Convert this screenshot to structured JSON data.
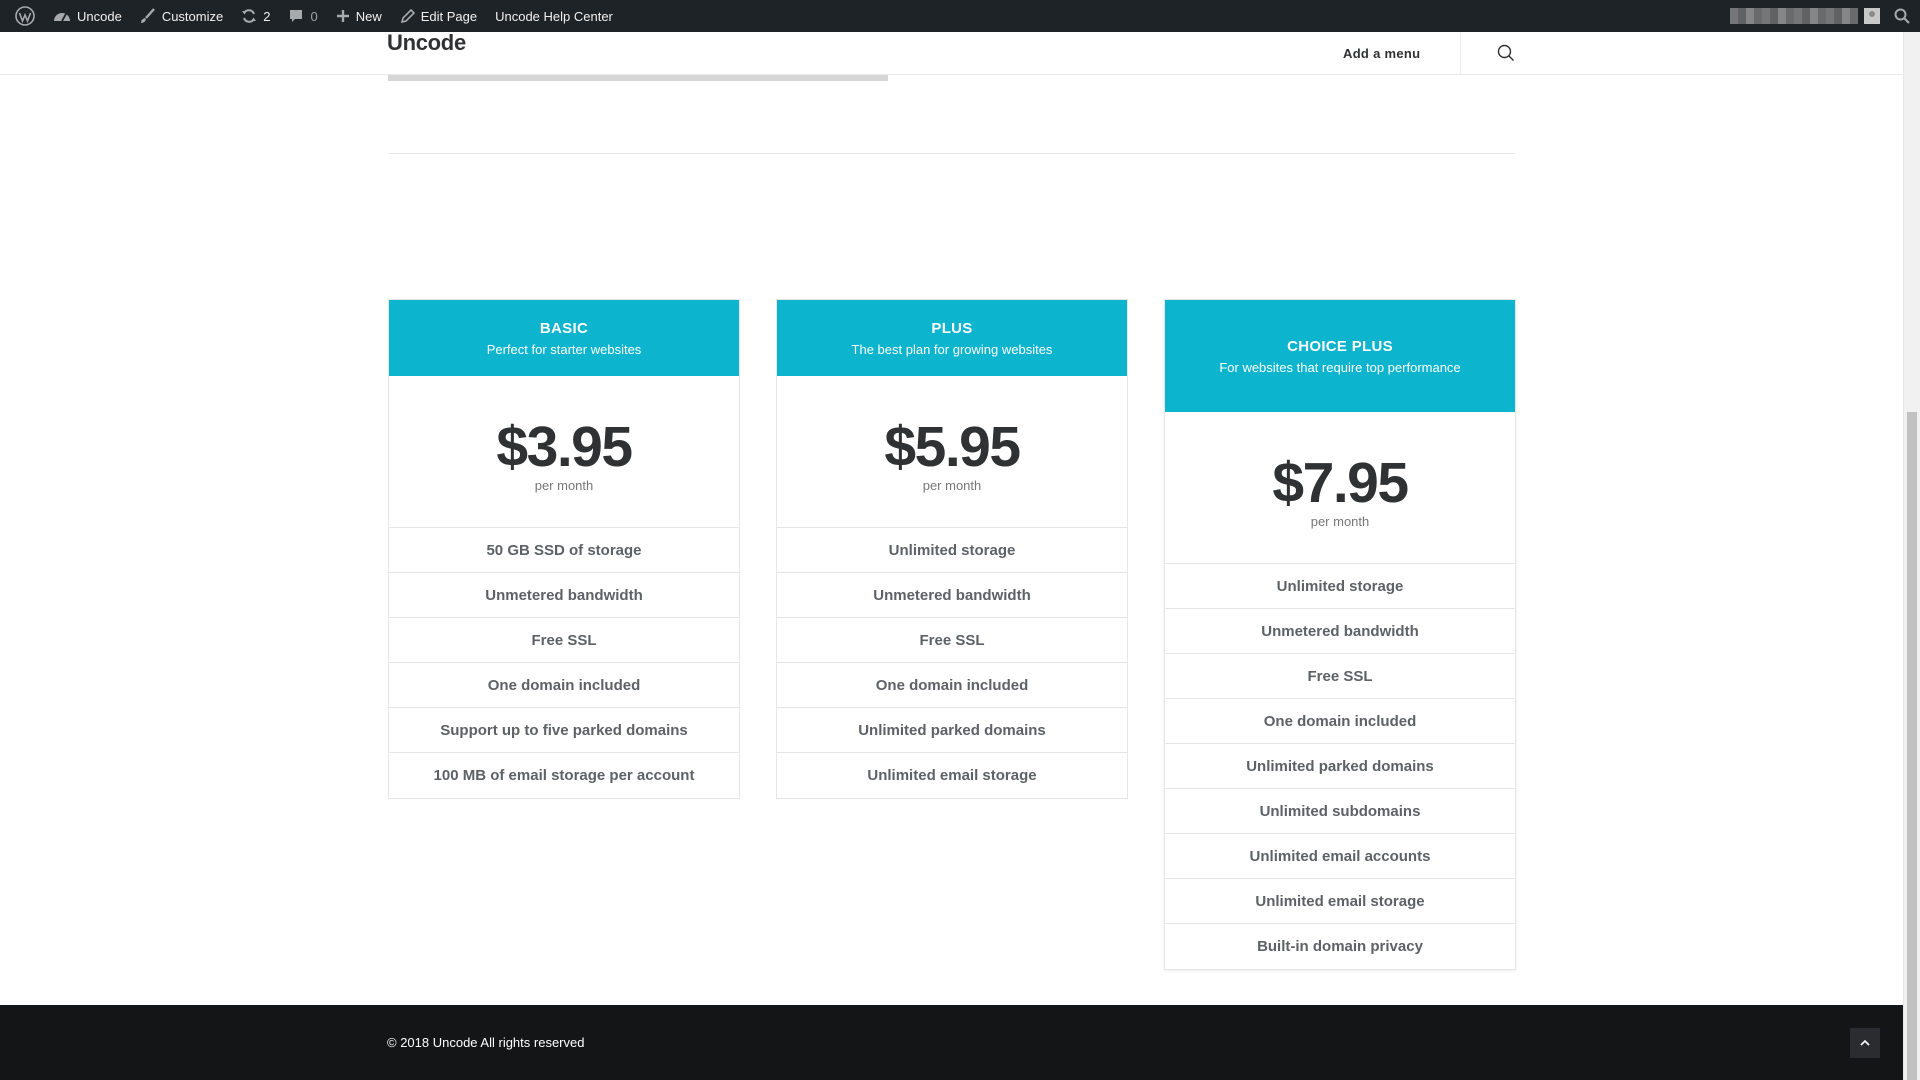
{
  "admin_bar": {
    "site_name": "Uncode",
    "customize": "Customize",
    "updates_count": "2",
    "comments_count": "0",
    "new_label": "New",
    "edit_page": "Edit Page",
    "help_center": "Uncode Help Center"
  },
  "header": {
    "logo": "Uncode",
    "menu_link": "Add a menu"
  },
  "plans": [
    {
      "name": "BASIC",
      "tagline": "Perfect for starter websites",
      "price": "$3.95",
      "period": "per month",
      "features": [
        "50 GB SSD of storage",
        "Unmetered bandwidth",
        "Free SSL",
        "One domain included",
        "Support up to five parked domains",
        "100 MB of email storage per account"
      ]
    },
    {
      "name": "PLUS",
      "tagline": "The best plan for growing websites",
      "price": "$5.95",
      "period": "per month",
      "features": [
        "Unlimited storage",
        "Unmetered bandwidth",
        "Free SSL",
        "One domain included",
        "Unlimited parked domains",
        "Unlimited email storage"
      ]
    },
    {
      "name": "CHOICE PLUS",
      "tagline": "For websites that require top performance",
      "price": "$7.95",
      "period": "per month",
      "features": [
        "Unlimited storage",
        "Unmetered bandwidth",
        "Free SSL",
        "One domain included",
        "Unlimited parked domains",
        "Unlimited subdomains",
        "Unlimited email accounts",
        "Unlimited email storage",
        "Built-in domain privacy"
      ]
    }
  ],
  "footer": {
    "copyright": "© 2018 Uncode All rights reserved"
  },
  "colors": {
    "accent": "#0cb4ce",
    "admin_bar": "#1d2327",
    "footer": "#141517"
  }
}
